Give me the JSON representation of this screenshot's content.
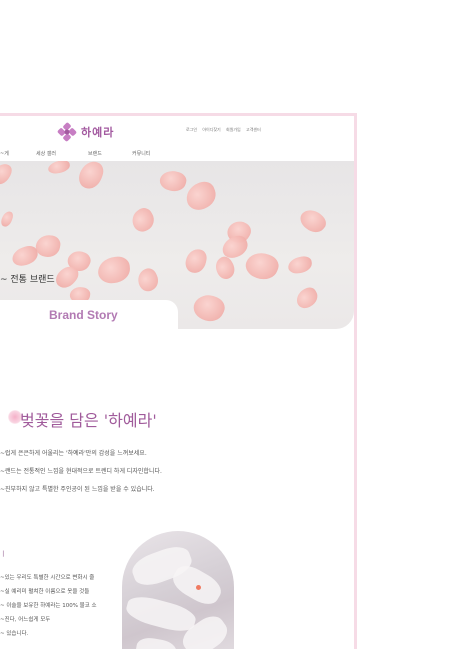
{
  "brand": {
    "name": "하예라"
  },
  "util_links": [
    "로그인",
    "아이디찾기",
    "회원가입",
    "고객센터"
  ],
  "nav": [
    "~게",
    "세상 갤러",
    "브랜드",
    "커뮤니티"
  ],
  "hero": {
    "caption": "~ 전통 브랜드"
  },
  "story_tab": "Brand Story",
  "headline": "벚꽃을 담은 '하예라'",
  "intro_lines": [
    "~럽게 은은하게 어울리는 '하예라'만의 감성을 느껴보세요.",
    "~랜드는 전통적인 느낌을 현대적으로 트렌디 하게 디자인합니다.",
    "~진부하지 않고 특별한 주인공이 된 느낌을 받을 수 있습니다."
  ],
  "sub_mark": "ㅣ",
  "body_lines": [
    "~있는 우리도 특별한 시간으로 변화시 줄",
    "~실 예리미 펼쳐한 이름으로 옷을 것들",
    "~ 이술을 보유한 하예라는 100% 물코 소",
    "~진다, 어느쉽게 모두",
    "~ 있습니다."
  ],
  "colors": {
    "accent": "#a35aa0",
    "petal": "#f2b3ae",
    "frame_border": "#f6dbe6"
  },
  "icons": {
    "logo": "flower-logo-icon"
  }
}
